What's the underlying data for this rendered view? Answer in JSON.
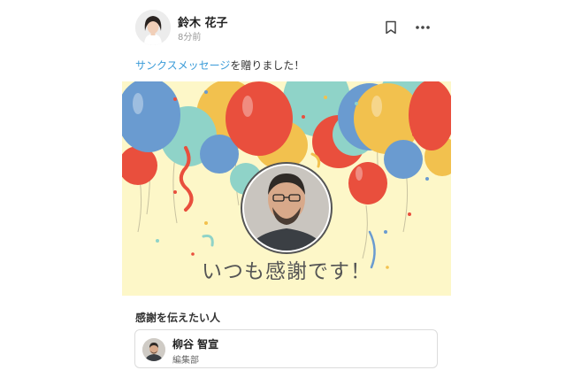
{
  "post": {
    "author_name": "鈴木 花子",
    "time": "8分前",
    "message_link": "サンクスメッセージ",
    "message_rest": "を贈りました！"
  },
  "card": {
    "text": "いつも感謝です！"
  },
  "recipients": {
    "heading": "感謝を伝えたい人",
    "items": [
      {
        "name": "柳谷 智宣",
        "department": "編集部"
      }
    ]
  },
  "icons": {
    "bookmark": "bookmark-icon",
    "more": "more-icon"
  },
  "colors": {
    "link": "#3a9bd8",
    "card_background": "#fdf7c8"
  }
}
